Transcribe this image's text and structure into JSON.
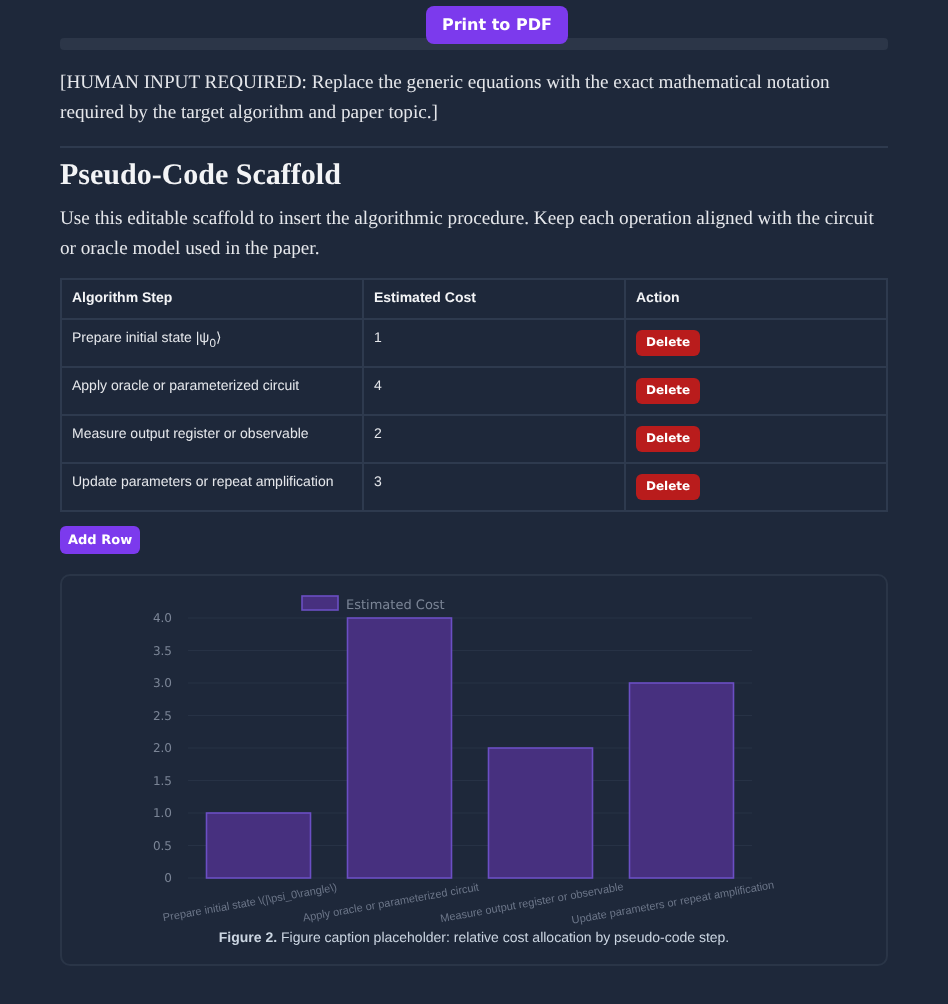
{
  "toolbar": {
    "print_button": "Print to PDF"
  },
  "note": "[HUMAN INPUT REQUIRED: Replace the generic equations with the exact mathematical notation required by the target algorithm and paper topic.]",
  "section": {
    "title": "Pseudo-Code Scaffold",
    "intro": "Use this editable scaffold to insert the algorithmic procedure. Keep each operation aligned with the circuit or oracle model used in the paper."
  },
  "table": {
    "columns": [
      "Algorithm Step",
      "Estimated Cost",
      "Action"
    ],
    "rows": [
      {
        "step": "Prepare initial state |ψ$_{0}$⟩",
        "cost": "1",
        "action": "Delete"
      },
      {
        "step": "Apply oracle or parameterized circuit",
        "cost": "4",
        "action": "Delete"
      },
      {
        "step": "Measure output register or observable",
        "cost": "2",
        "action": "Delete"
      },
      {
        "step": "Update parameters or repeat amplification",
        "cost": "3",
        "action": "Delete"
      }
    ]
  },
  "add_row_button": "Add Row",
  "figure": {
    "chart_data": {
      "type": "bar",
      "categories": [
        "Prepare initial state \\(|\\psi_0\\rangle\\)",
        "Apply oracle or parameterized circuit",
        "Measure output register or observable",
        "Update parameters or repeat amplification"
      ],
      "series": [
        {
          "name": "Estimated Cost",
          "color": "#47307f",
          "values": [
            1,
            4,
            2,
            3
          ]
        }
      ],
      "ylim": [
        0,
        4
      ],
      "grid": true,
      "yticks": [
        {
          "value": 0,
          "label": "0"
        },
        {
          "value": 0.5,
          "label": "0.5"
        },
        {
          "value": 1,
          "label": "1.0"
        },
        {
          "value": 1.5,
          "label": "1.5"
        },
        {
          "value": 2,
          "label": "2.0"
        },
        {
          "value": 2.5,
          "label": "2.5"
        },
        {
          "value": 3,
          "label": "3.0"
        },
        {
          "value": 3.5,
          "label": "3.5"
        },
        {
          "value": 4,
          "label": "4.0"
        }
      ]
    },
    "caption": "**Figure 2.** Figure caption placeholder: relative cost allocation by pseudo-code step."
  }
}
